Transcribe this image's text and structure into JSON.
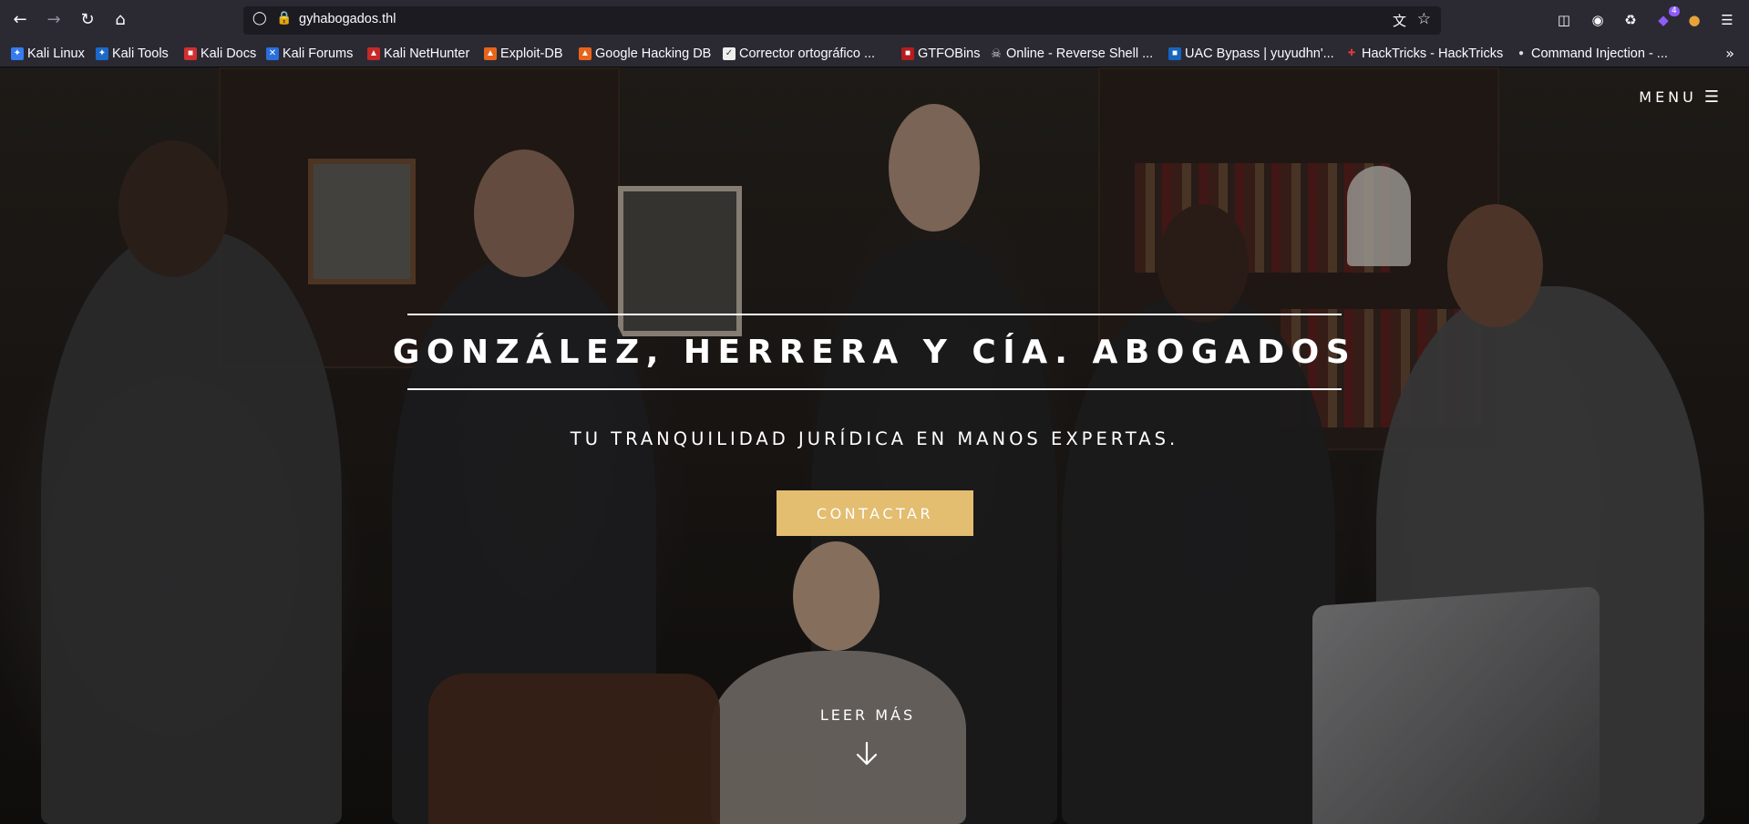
{
  "browser": {
    "url": "gyhabogados.thl",
    "extension_badge": "4"
  },
  "bookmarks": [
    {
      "label": "Kali Linux",
      "icon": "kali-icon",
      "color": "#367bf0"
    },
    {
      "label": "Kali Tools",
      "icon": "kali-tools-icon",
      "color": "#1b6ac9"
    },
    {
      "label": "Kali Docs",
      "icon": "kali-docs-icon",
      "color": "#d32f2f"
    },
    {
      "label": "Kali Forums",
      "icon": "kali-forums-icon",
      "color": "#2a6fdb"
    },
    {
      "label": "Kali NetHunter",
      "icon": "nethunter-icon",
      "color": "#c62828"
    },
    {
      "label": "Exploit-DB",
      "icon": "exploit-db-icon",
      "color": "#e8641b"
    },
    {
      "label": "Google Hacking DB",
      "icon": "ghdb-icon",
      "color": "#e8641b"
    },
    {
      "label": "Corrector ortográfico ...",
      "icon": "corrector-icon",
      "color": "#eeeeee"
    },
    {
      "label": "GTFOBins",
      "icon": "gtfobins-icon",
      "color": "#b71c1c"
    },
    {
      "label": "Online - Reverse Shell ...",
      "icon": "skull-icon",
      "color": "#9e9e9e"
    },
    {
      "label": "UAC Bypass | yuyudhn'...",
      "icon": "uac-icon",
      "color": "#1565c0"
    },
    {
      "label": "HackTricks - HackTricks",
      "icon": "hacktricks-icon",
      "color": "#c62828"
    },
    {
      "label": "Command Injection - ...",
      "icon": "command-injection-icon",
      "color": "#dddddd"
    }
  ],
  "page": {
    "menu_label": "MENU",
    "title": "GONZÁLEZ, HERRERA Y CÍA. ABOGADOS",
    "subtitle": "TU TRANQUILIDAD JURÍDICA EN MANOS EXPERTAS.",
    "cta_label": "CONTACTAR",
    "read_more_label": "LEER MÁS",
    "accent_color": "#e3bd70"
  }
}
